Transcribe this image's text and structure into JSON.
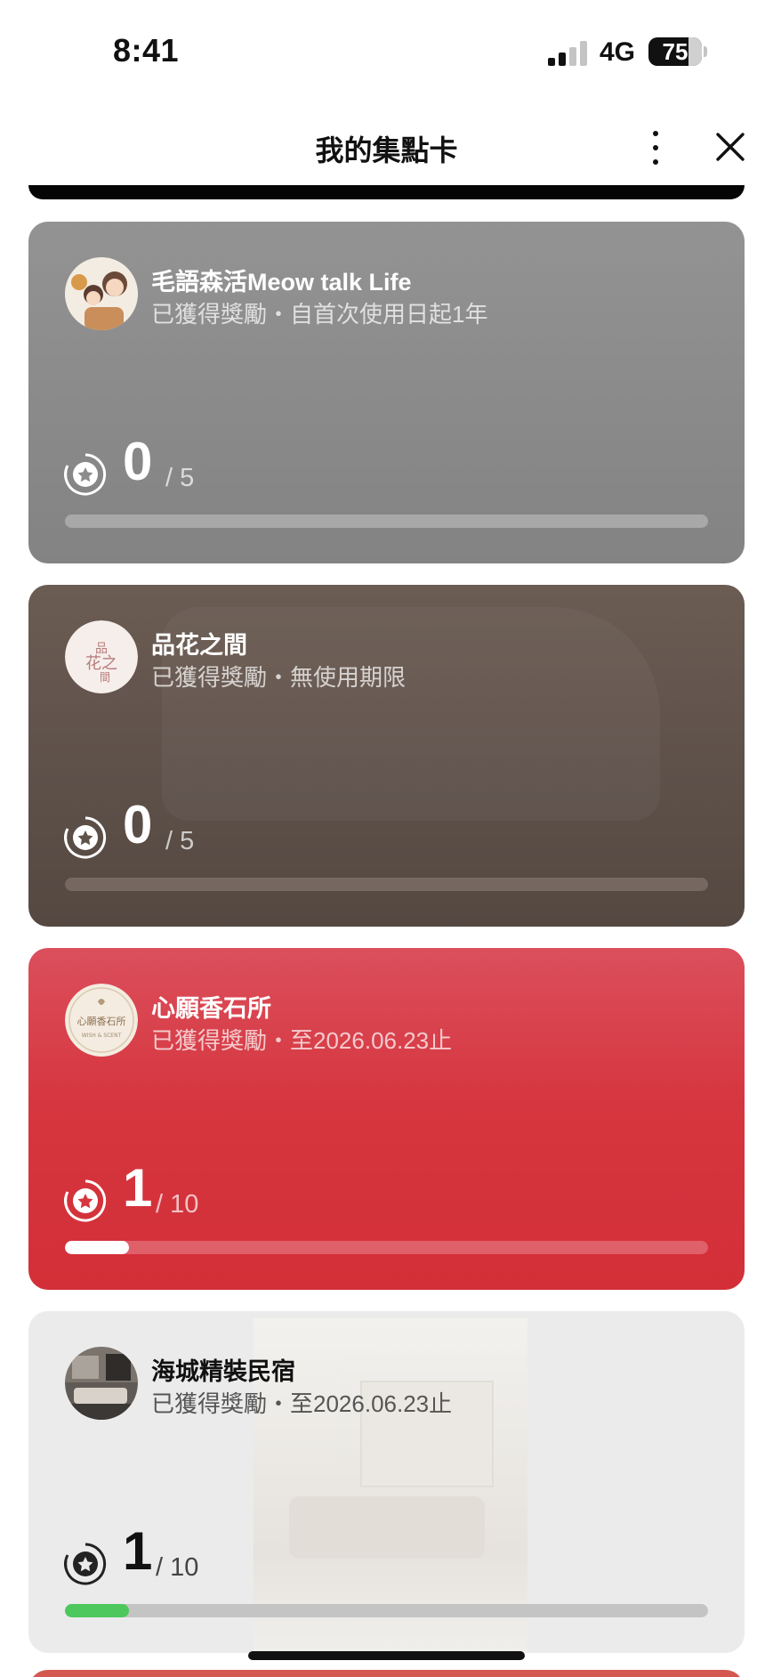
{
  "status_bar": {
    "time": "8:41",
    "network": "4G",
    "battery": "75"
  },
  "nav": {
    "title": "我的集點卡"
  },
  "cards": [
    {
      "name": "毛語森活Meow talk Life",
      "reward": "已獲得獎勵・自首次使用日起1年",
      "count": "0",
      "total": "/ 5",
      "progress": 0
    },
    {
      "name": "品花之間",
      "reward": "已獲得獎勵・無使用期限",
      "count": "0",
      "total": "/ 5",
      "progress": 0
    },
    {
      "name": "心願香石所",
      "reward": "已獲得獎勵・至2026.06.23止",
      "count": "1",
      "total": "/ 10",
      "progress": 0.1,
      "bar_color": "#ffffff"
    },
    {
      "name": "海城精裝民宿",
      "reward": "已獲得獎勵・至2026.06.23止",
      "count": "1",
      "total": "/ 10",
      "progress": 0.1,
      "bar_color": "#4cc85c"
    }
  ],
  "colors": {
    "card1": "#8d8d8d",
    "card2": "#5f5249",
    "card3": "#d6363f",
    "card4": "#ebebeb"
  }
}
